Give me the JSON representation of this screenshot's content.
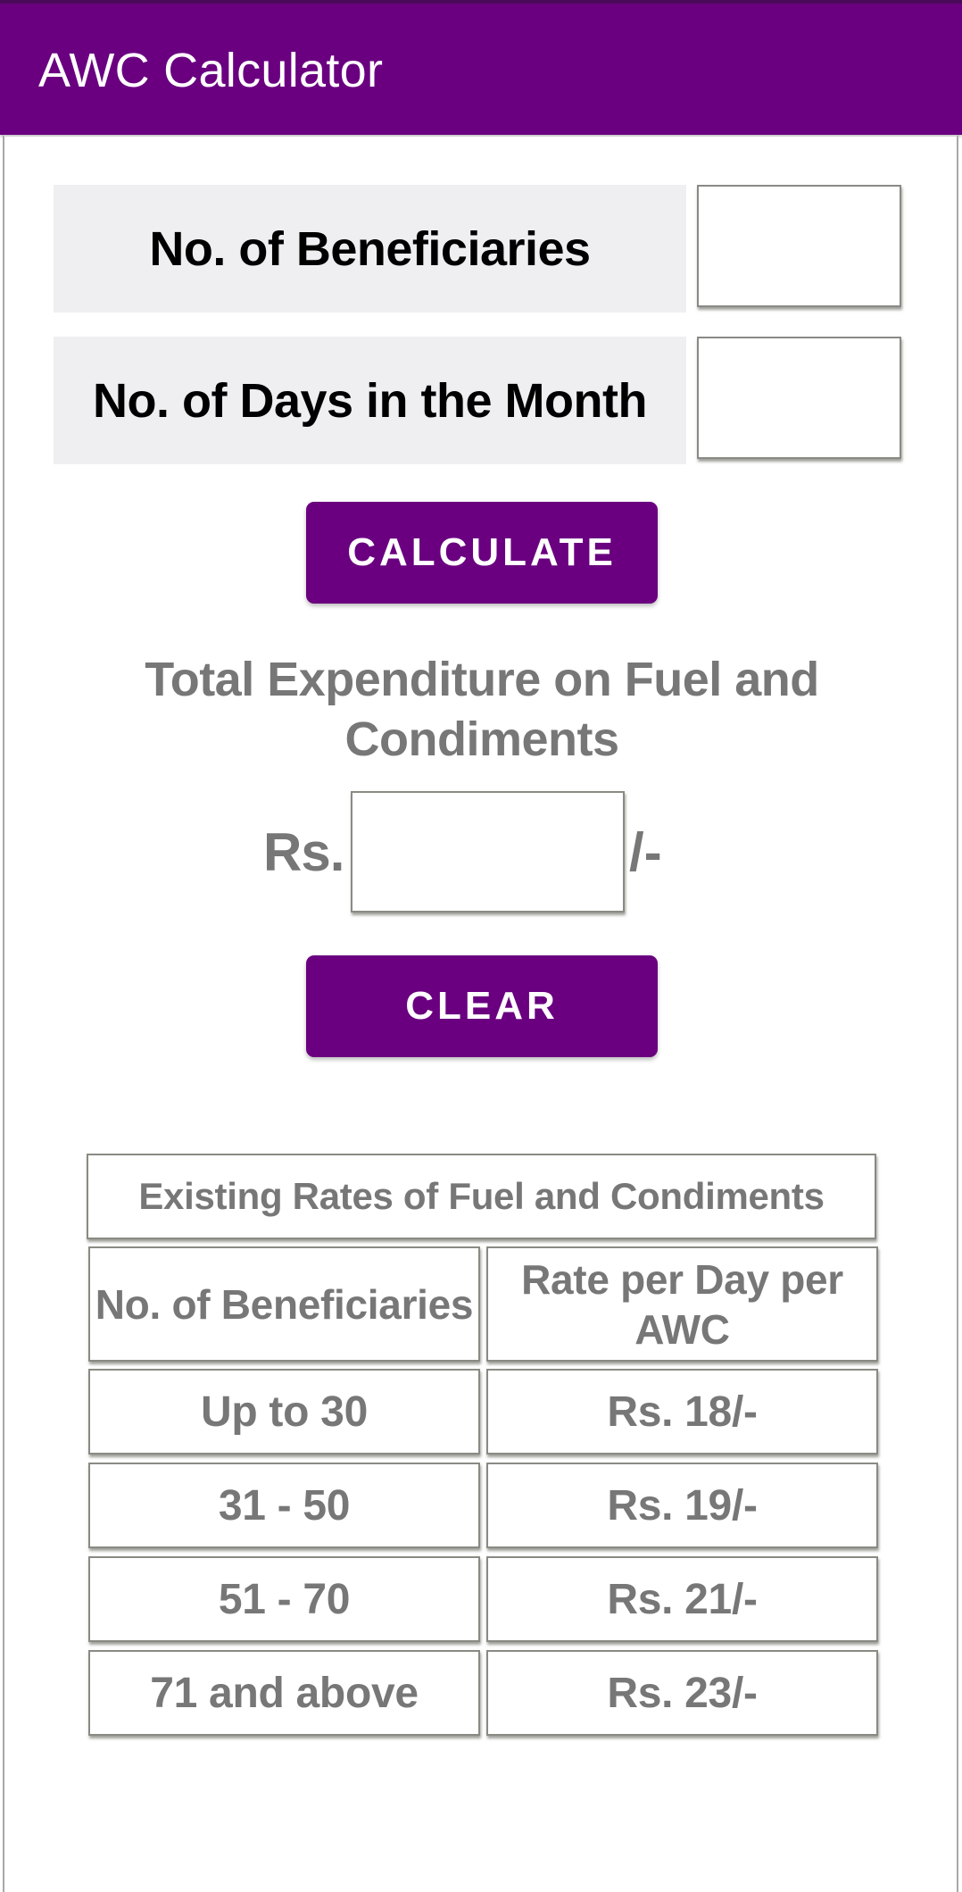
{
  "app_bar": {
    "title": "AWC Calculator",
    "color": "#6a0080"
  },
  "form": {
    "beneficiaries": {
      "label": "No. of Beneficiaries",
      "value": ""
    },
    "days": {
      "label": "No. of Days in the Month",
      "value": ""
    },
    "calculate_label": "CALCULATE"
  },
  "result": {
    "title": "Total Expenditure on Fuel and Condiments",
    "prefix": "Rs.",
    "value": "",
    "suffix": "/-"
  },
  "clear_label": "CLEAR",
  "rates_table": {
    "title": "Existing Rates of Fuel and Condiments",
    "headers": [
      "No. of Beneficiaries",
      "Rate per Day per AWC"
    ],
    "rows": [
      {
        "range": "Up to 30",
        "rate": "Rs. 18/-"
      },
      {
        "range": "31 - 50",
        "rate": "Rs. 19/-"
      },
      {
        "range": "51 - 70",
        "rate": "Rs. 21/-"
      },
      {
        "range": "71 and above",
        "rate": "Rs. 23/-"
      }
    ]
  }
}
